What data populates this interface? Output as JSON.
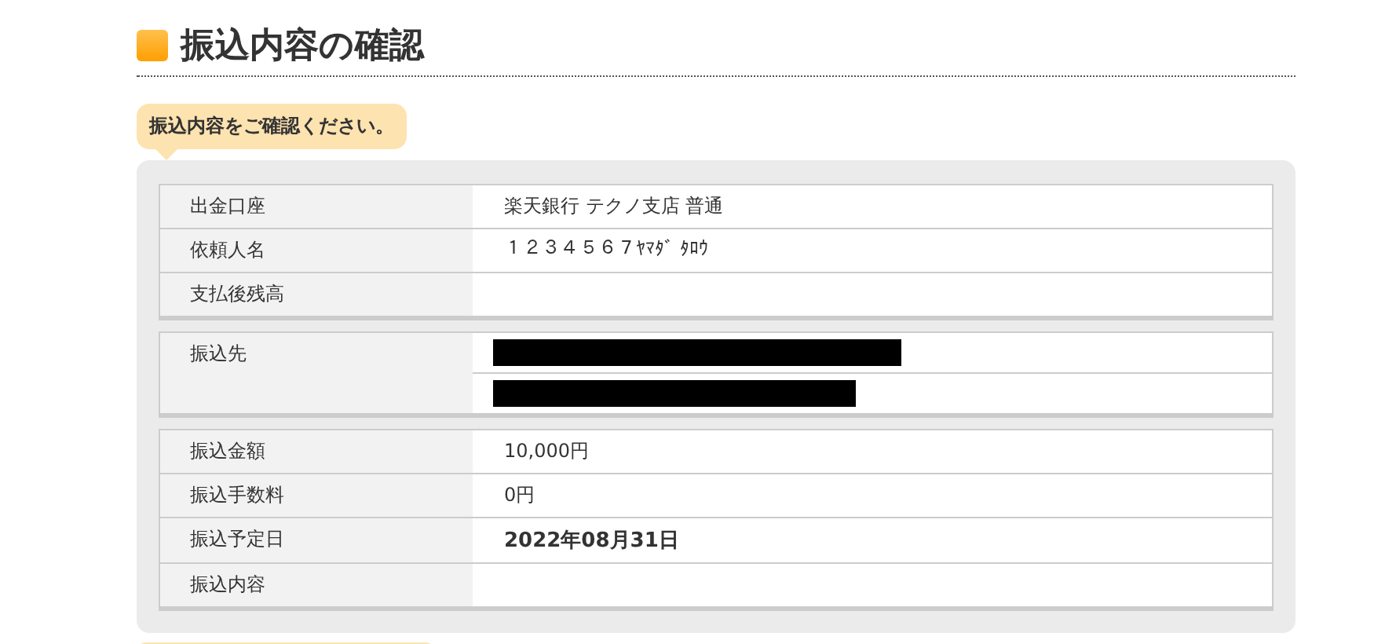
{
  "heading": "振込内容の確認",
  "notice": "振込内容をご確認ください。",
  "groups": [
    {
      "rows": [
        {
          "label": "出金口座",
          "value": "楽天銀行  テクノ支店  普通"
        },
        {
          "label": "依頼人名",
          "value": "１２３４５６７ﾔﾏﾀﾞ ﾀﾛｳ"
        },
        {
          "label": "支払後残高"
        }
      ]
    },
    {
      "rows": [
        {
          "label": "振込先",
          "lines": [
            {
              "kind": "redacted"
            },
            {
              "kind": "redacted"
            }
          ]
        }
      ]
    },
    {
      "rows": [
        {
          "label": "振込金額",
          "value": "10,000円"
        },
        {
          "label": "振込手数料",
          "value": "0円"
        },
        {
          "label": "振込予定日",
          "value": "2022年08月31日",
          "bold": true
        },
        {
          "label": "振込内容"
        }
      ]
    }
  ]
}
